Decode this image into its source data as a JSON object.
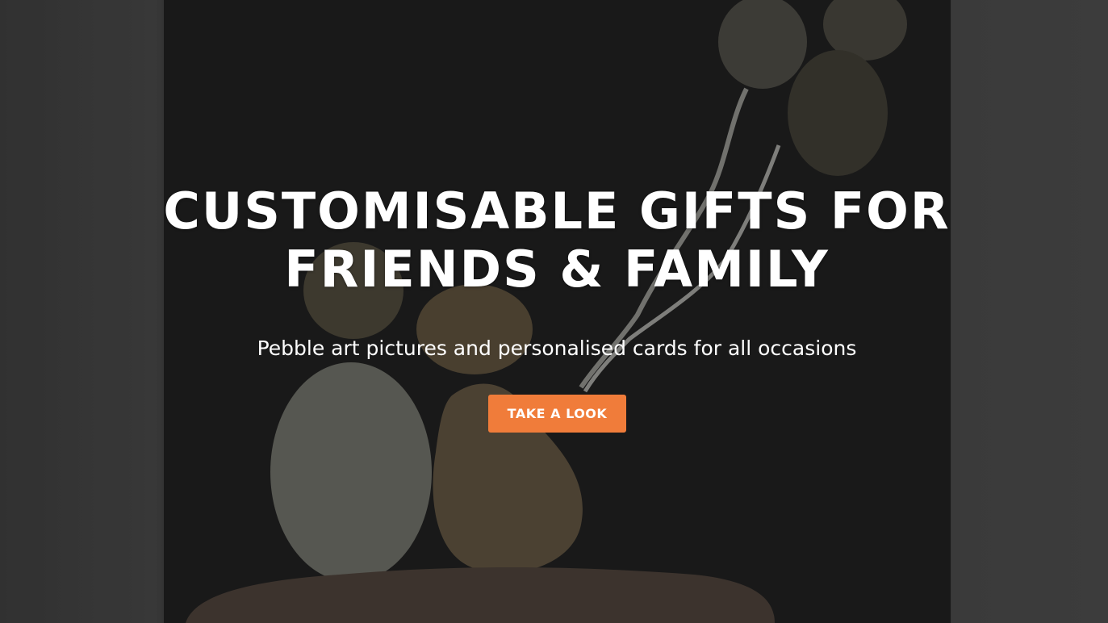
{
  "hero": {
    "title_line1": "CUSTOMISABLE GIFTS FOR",
    "title_line2": "FRIENDS & FAMILY",
    "subtitle": "Pebble art pictures and personalised cards for all occasions",
    "cta_label": "TAKE A LOOK"
  },
  "colors": {
    "accent": "#f07c3a",
    "text": "#ffffff",
    "frame_background": "#222222"
  },
  "icons": [
    "pebble-art-image"
  ]
}
